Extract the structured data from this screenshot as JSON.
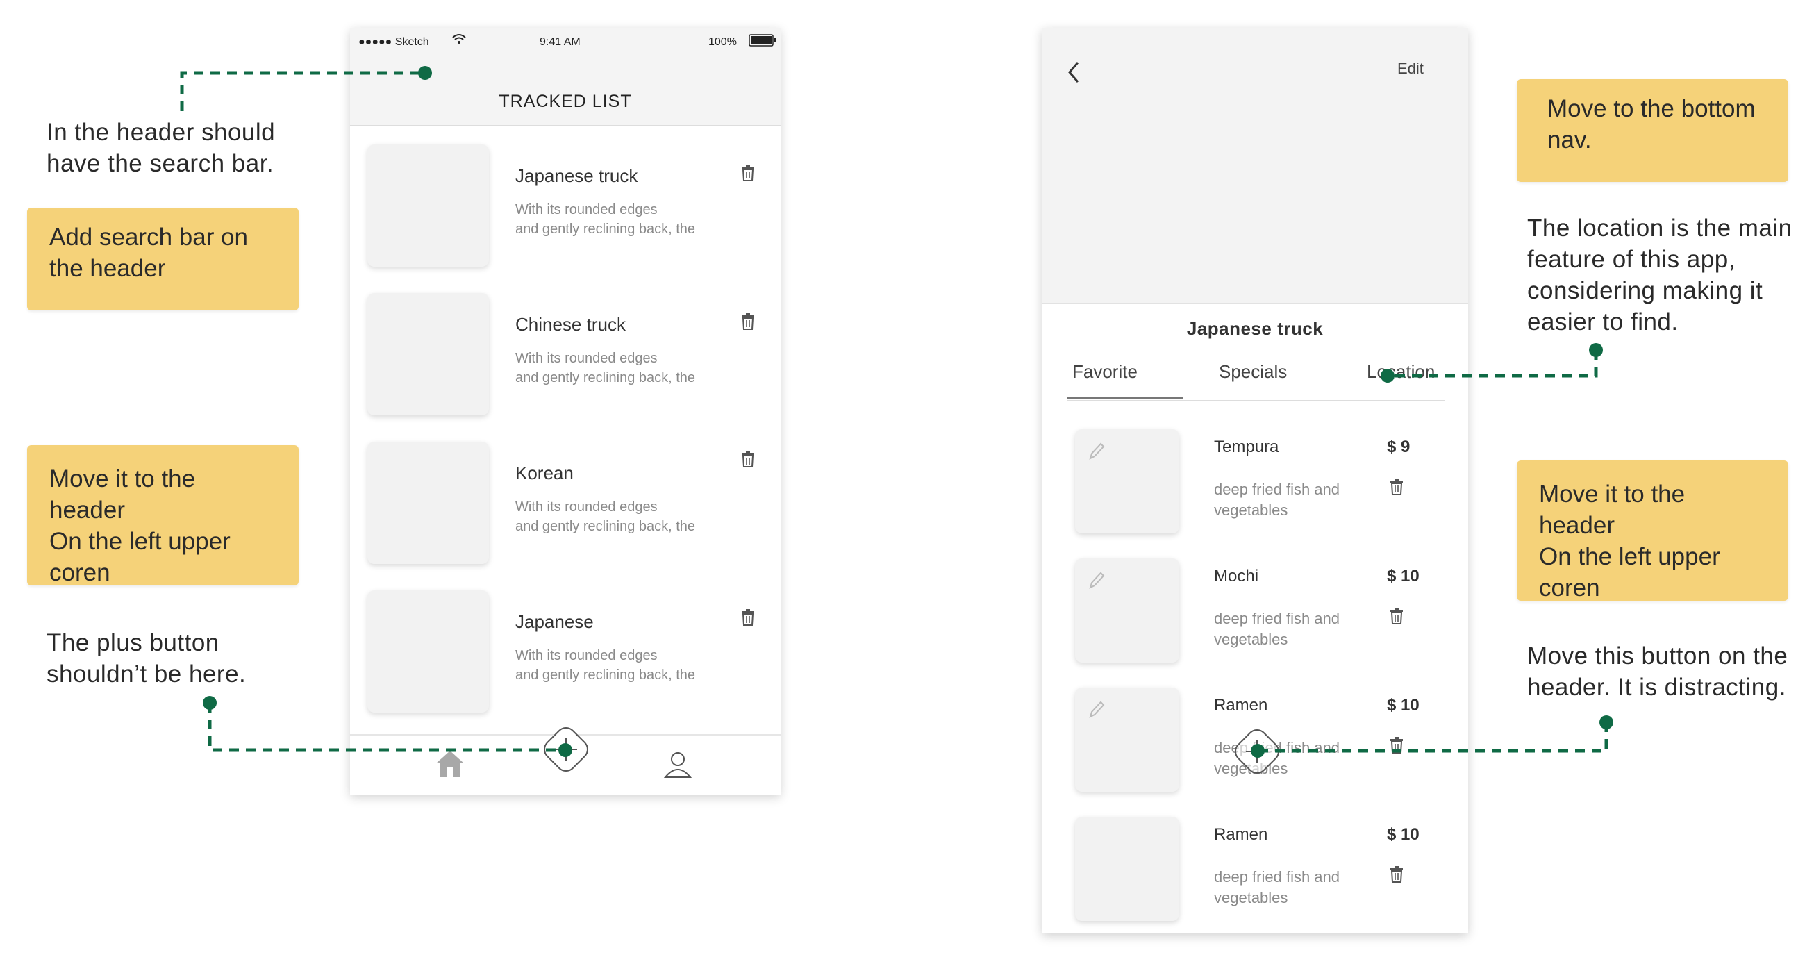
{
  "annotations": {
    "left_search_note": "In the header should\nhave the search bar.",
    "left_search_sticky": "Add search bar on\nthe header",
    "left_move_sticky": "Move it to the header\nOn the left upper\ncoren",
    "left_plus_note": "The plus button\nshouldn’t be here.",
    "right_bottom_sticky": "Move to the bottom\nnav.",
    "right_location_note": "The location is the main\nfeature of this app,\nconsidering making it\neasier to find.",
    "right_move_sticky": "Move it to the header\nOn the left upper\ncoren",
    "right_button_note": "Move this button on the\nheader. It is distracting."
  },
  "tracked_screen": {
    "status": {
      "carrier": "●●●●● Sketch",
      "time": "9:41 AM",
      "battery": "100%"
    },
    "title": "TRACKED LIST",
    "cards": [
      {
        "title": "Japanese truck",
        "desc": "With its rounded edges\nand gently reclining back, the"
      },
      {
        "title": "Chinese truck",
        "desc": "With its rounded edges\nand gently reclining back, the"
      },
      {
        "title": "Korean",
        "desc": "With its rounded edges\nand gently reclining back, the"
      },
      {
        "title": "Japanese",
        "desc": "With its rounded edges\nand gently reclining back, the"
      }
    ],
    "tabbar": {
      "home": "home-icon",
      "add": "plus-icon",
      "profile": "user-icon"
    }
  },
  "detail_screen": {
    "edit_label": "Edit",
    "title": "Japanese truck",
    "tabs": [
      "Favorite",
      "Specials",
      "Location"
    ],
    "active_tab": "Favorite",
    "items": [
      {
        "name": "Tempura",
        "price": "$ 9",
        "desc": "deep fried fish and\nvegetables"
      },
      {
        "name": "Mochi",
        "price": "$ 10",
        "desc": "deep fried fish and\nvegetables"
      },
      {
        "name": "Ramen",
        "price": "$ 10",
        "desc": "deep fried fish and\nvegetables"
      },
      {
        "name": "Ramen",
        "price": "$ 10",
        "desc": "deep fried fish and\nvegetables"
      }
    ]
  },
  "colors": {
    "sticky": "#f5d279",
    "annotation_line": "#0f6a45",
    "header_bg": "#f4f4f4"
  }
}
